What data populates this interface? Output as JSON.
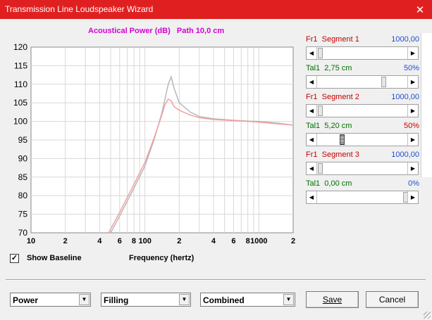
{
  "window": {
    "title": "Transmission Line Loudspeaker Wizard",
    "close_glyph": "✕"
  },
  "chart_title": "Acoustical Power (dB)   Path 10,0 cm",
  "chart_data": {
    "type": "line",
    "title": "Acoustical Power (dB)   Path 10,0 cm",
    "xlabel": "Frequency (hertz)",
    "ylabel": "",
    "x_scale": "log",
    "xlim": [
      10,
      2000
    ],
    "ylim": [
      70,
      120
    ],
    "grid": true,
    "y_ticks": [
      120,
      115,
      110,
      105,
      100,
      95,
      90,
      85,
      80,
      75,
      70
    ],
    "x_tick_labels": [
      "10",
      "2",
      "4",
      "6",
      "8",
      "100",
      "2",
      "4",
      "6",
      "8",
      "1000",
      "2"
    ],
    "series": [
      {
        "color": "#b8b8b8",
        "x": [
          50,
          60,
          80,
          100,
          120,
          140,
          150,
          160,
          170,
          180,
          200,
          250,
          300,
          400,
          600,
          800,
          1000,
          1500,
          2000
        ],
        "y": [
          70,
          74.5,
          82,
          88,
          95,
          102,
          106,
          110,
          112,
          109,
          105,
          102.5,
          101.3,
          100.7,
          100.3,
          100.1,
          100,
          99.5,
          99
        ]
      },
      {
        "color": "#f4a0a0",
        "x": [
          48,
          60,
          80,
          100,
          120,
          140,
          150,
          160,
          170,
          180,
          200,
          250,
          300,
          400,
          600,
          800,
          1000,
          1500,
          2000
        ],
        "y": [
          70,
          75.5,
          83,
          89,
          95.5,
          101.5,
          104.5,
          106,
          105.5,
          104,
          103,
          101.7,
          101,
          100.5,
          100.2,
          100,
          99.8,
          99.3,
          99
        ]
      }
    ]
  },
  "segments": [
    {
      "label": "Fr1  Segment 1",
      "value": "1000,00"
    },
    {
      "label": "Tal1  2,75 cm",
      "value": "50%"
    },
    {
      "label": "Fr1  Segment 2",
      "value": "1000,00"
    },
    {
      "label": "Tal1  5,20 cm",
      "value": "50%"
    },
    {
      "label": "Fr1  Segment 3",
      "value": "1000,00"
    },
    {
      "label": "Tal1  0,00 cm",
      "value": "0%"
    }
  ],
  "controls": {
    "show_baseline_label": "Show Baseline",
    "show_baseline_checked": true,
    "x_axis_label": "Frequency (hertz)",
    "dropdowns": [
      {
        "value": "Power"
      },
      {
        "value": "Filling"
      },
      {
        "value": "Combined"
      }
    ],
    "save_label": "Save",
    "cancel_label": "Cancel"
  },
  "colors": {
    "titlebar": "#e02020",
    "chart_title": "#d400d4",
    "series_gray": "#b8b8b8",
    "series_pink": "#f4a0a0"
  }
}
